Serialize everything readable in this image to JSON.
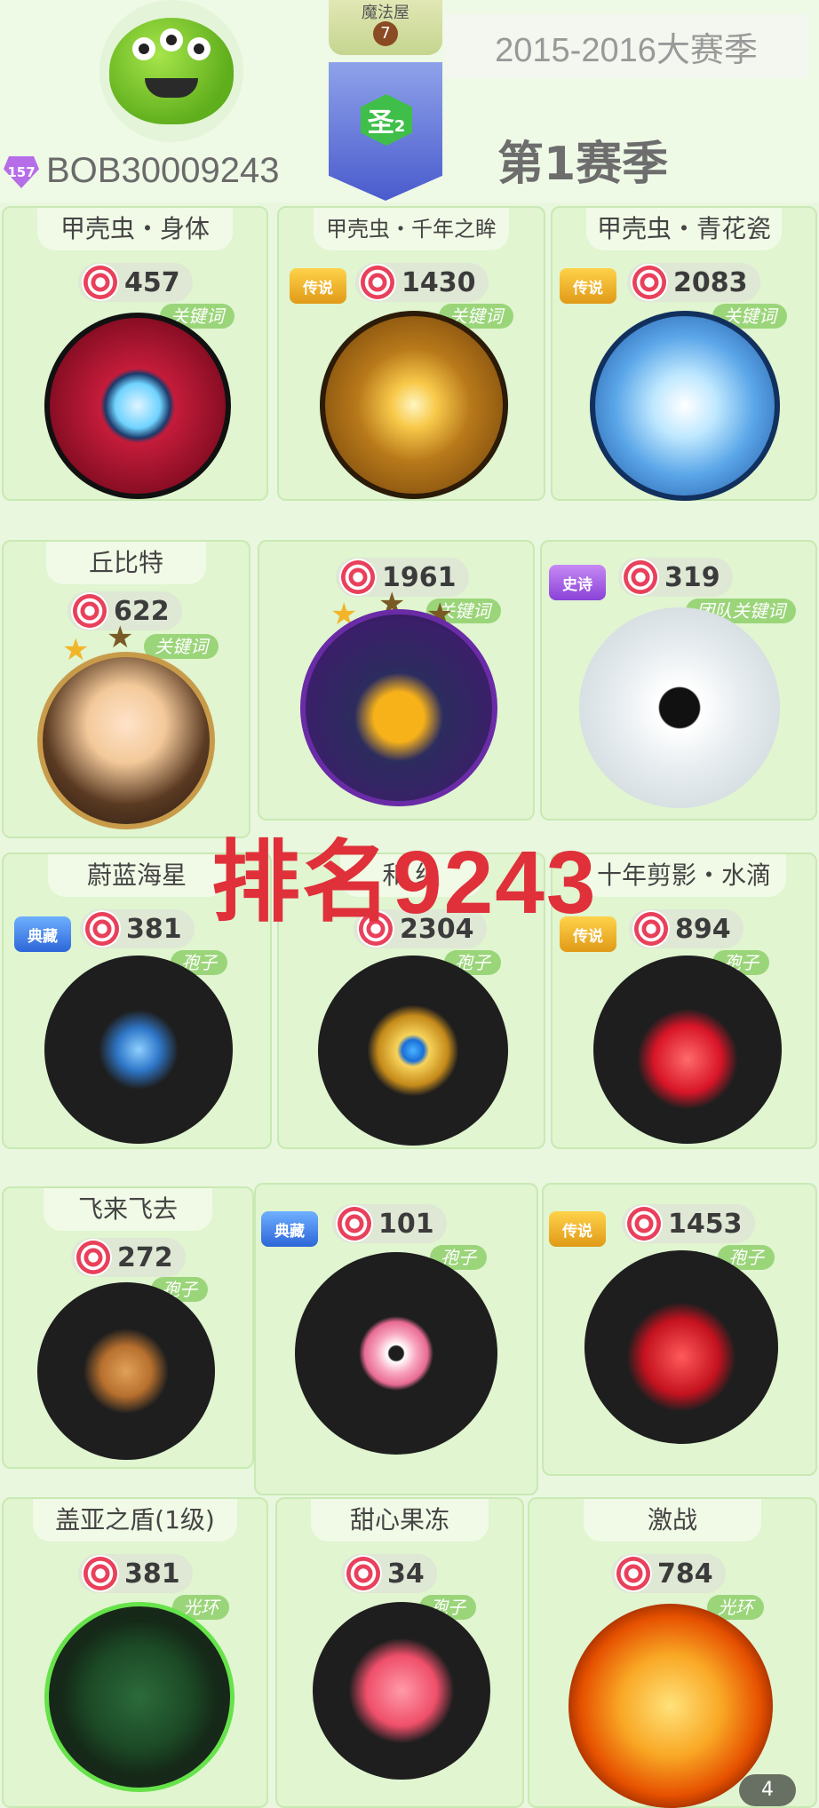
{
  "header": {
    "player_level": "157",
    "player_id": "BOB30009243",
    "house_label": "魔法屋",
    "house_level": "7",
    "rank_label": "圣",
    "rank_level": "2",
    "season_years": "2015-2016大赛季",
    "season_name": "第1赛季"
  },
  "watermark": "排名9243",
  "cards": [
    {
      "title": "甲壳虫・身体",
      "value": "457",
      "tag": "关键词",
      "badge": ""
    },
    {
      "title": "甲壳虫・千年之眸",
      "value": "1430",
      "tag": "关键词",
      "badge": "传说"
    },
    {
      "title": "甲壳虫・青花瓷",
      "value": "2083",
      "tag": "关键词",
      "badge": "传说"
    },
    {
      "title": "丘比特",
      "value": "622",
      "tag": "关键词",
      "badge": ""
    },
    {
      "title": "",
      "value": "1961",
      "tag": "关键词",
      "badge": ""
    },
    {
      "title": "",
      "value": "319",
      "tag": "团队关键词",
      "badge": "史诗"
    },
    {
      "title": "蔚蓝海星",
      "value": "381",
      "tag": "孢子",
      "badge": "典藏"
    },
    {
      "title": "和  级",
      "value": "2304",
      "tag": "孢子",
      "badge": ""
    },
    {
      "title": "十年剪影・水滴",
      "value": "894",
      "tag": "孢子",
      "badge": "传说"
    },
    {
      "title": "飞来飞去",
      "value": "272",
      "tag": "孢子",
      "badge": ""
    },
    {
      "title": "",
      "value": "101",
      "tag": "孢子",
      "badge": "典藏"
    },
    {
      "title": "",
      "value": "1453",
      "tag": "孢子",
      "badge": "传说"
    },
    {
      "title": "盖亚之盾(1级)",
      "value": "381",
      "tag": "光环",
      "badge": ""
    },
    {
      "title": "甜心果冻",
      "value": "34",
      "tag": "孢子",
      "badge": ""
    },
    {
      "title": "激战",
      "value": "784",
      "tag": "光环",
      "badge": ""
    }
  ],
  "corner_count": "4"
}
